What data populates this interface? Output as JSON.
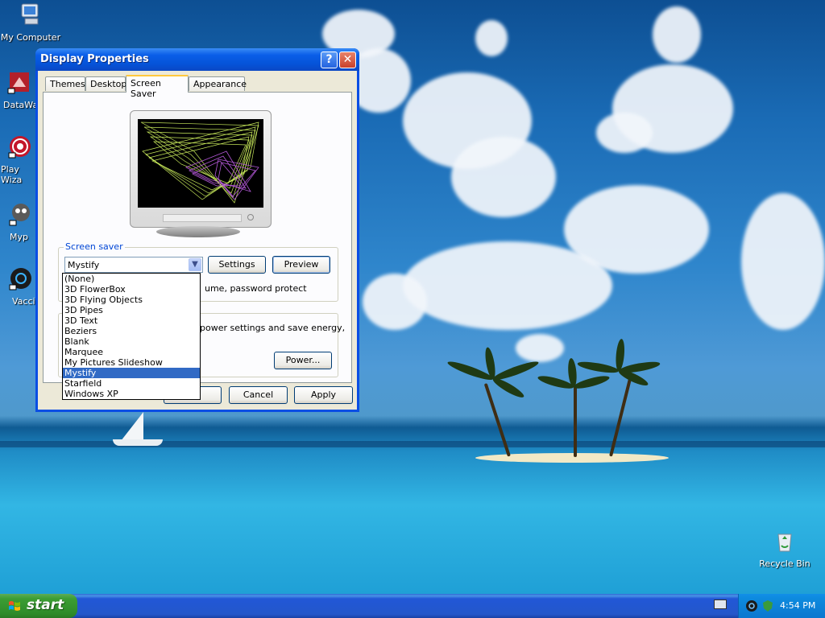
{
  "desktop": {
    "icons": [
      {
        "label": "My Computer"
      },
      {
        "label": "DataWa"
      },
      {
        "label": "Play Wiza"
      },
      {
        "label": "Myp"
      },
      {
        "label": "Vaccin"
      },
      {
        "label": "Recycle Bin"
      }
    ]
  },
  "window": {
    "title": "Display Properties",
    "help_glyph": "?",
    "close_glyph": "✕",
    "tabs": [
      {
        "label": "Themes"
      },
      {
        "label": "Desktop"
      },
      {
        "label": "Screen Saver",
        "active": true
      },
      {
        "label": "Appearance"
      }
    ],
    "screen_saver_group": {
      "legend": "Screen saver",
      "selected": "Mystify",
      "settings_label": "Settings",
      "preview_label": "Preview",
      "partial_text": "ume, password protect"
    },
    "power_group": {
      "partial_text": "power settings and save energy,",
      "power_button_label": "Power..."
    },
    "footer": {
      "cancel_label": "Cancel",
      "apply_label": "Apply"
    },
    "dropdown_options": [
      "(None)",
      "3D FlowerBox",
      "3D Flying Objects",
      "3D Pipes",
      "3D Text",
      "Beziers",
      "Blank",
      "Marquee",
      "My Pictures Slideshow",
      "Mystify",
      "Starfield",
      "Windows XP"
    ],
    "dropdown_selected_index": 9
  },
  "taskbar": {
    "start_label": "start",
    "clock": "4:54 PM"
  }
}
